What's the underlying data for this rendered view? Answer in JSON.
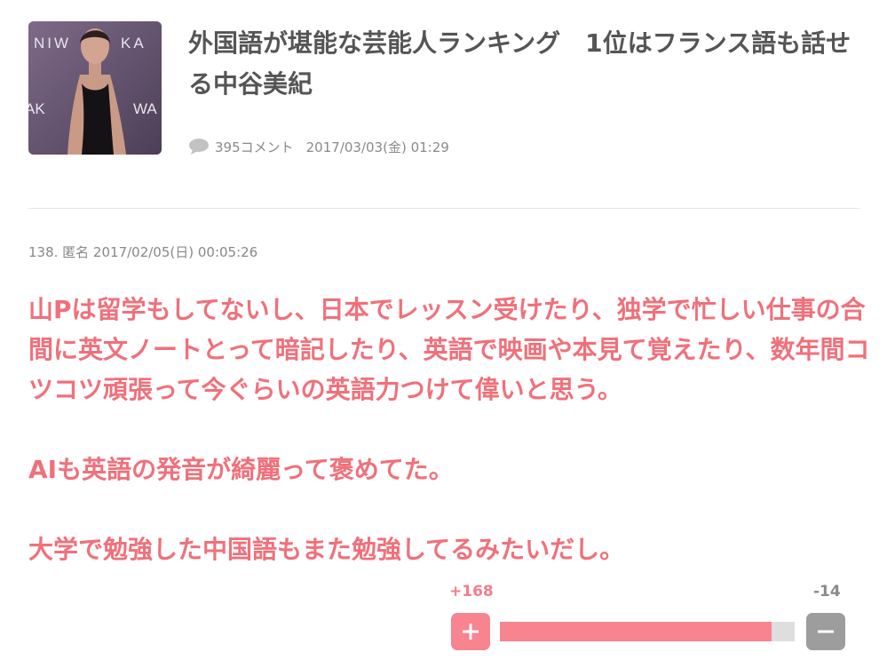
{
  "article": {
    "thumbnail_icon": "article-photo",
    "title": "外国語が堪能な芸能人ランキング　1位はフランス語も話せる中谷美紀",
    "comment_icon": "speech-bubble-icon",
    "comment_count": "395コメント",
    "date": "2017/03/03(金) 01:29"
  },
  "comment": {
    "header": "138. 匿名 2017/02/05(日) 00:05:26",
    "paragraphs": [
      "山Pは留学もしてないし、日本でレッスン受けたり、独学で忙しい仕事の合間に英文ノートとって暗記したり、英語で映画や本見て覚えたり、数年間コツコツ頑張って今ぐらいの英語力つけて偉いと思う。",
      "AIも英語の発音が綺麗って褒めてた。",
      "大学で勉強した中国語もまた勉強してるみたいだし。"
    ],
    "color": "#f0707a"
  },
  "vote": {
    "plus_label": "+168",
    "minus_label": "-14",
    "plus_value": 168,
    "minus_value": 14,
    "plus_icon": "plus-icon",
    "minus_icon": "minus-icon",
    "plus_color": "#f7848f",
    "minus_color": "#9d9d9d"
  }
}
